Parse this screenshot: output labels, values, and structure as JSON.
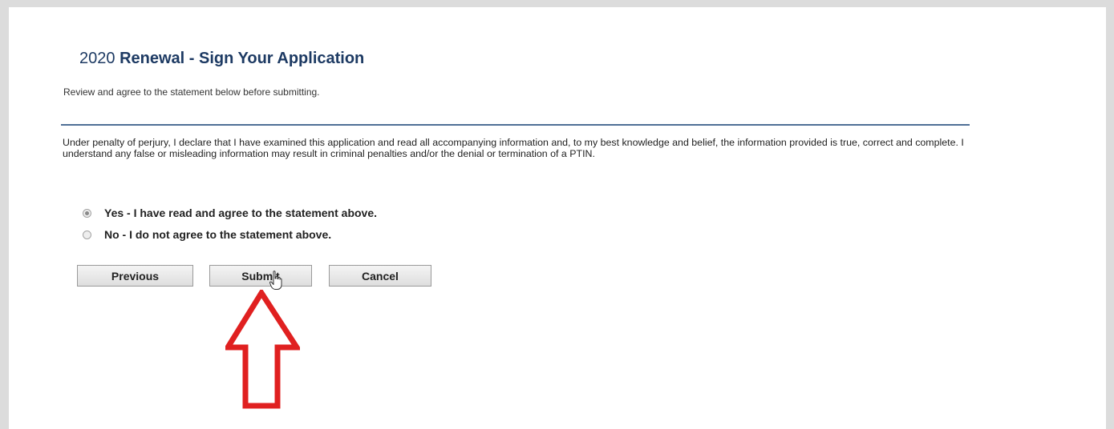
{
  "page": {
    "title_year": "2020",
    "title_main": "Renewal - Sign Your Application",
    "instruction": "Review and agree to the statement below before submitting.",
    "statement": "Under penalty of perjury, I declare that I have examined this application and read all accompanying information and, to my best knowledge and belief, the information provided is true, correct and complete. I understand any false or misleading information may result in criminal penalties and/or the denial or termination of a PTIN."
  },
  "radio_options": [
    {
      "label": "Yes - I have read and agree to the statement above.",
      "checked": true
    },
    {
      "label": "No - I do not agree to the statement above.",
      "checked": false
    }
  ],
  "buttons": {
    "previous": "Previous",
    "submit": "Submit",
    "cancel": "Cancel"
  },
  "colors": {
    "title": "#1d3a63",
    "divider": "#4f6f96",
    "annotation_arrow": "#e02020",
    "frame": "#dcdcdc"
  },
  "icons": {
    "cursor": "pointer-hand-icon",
    "annotation": "red-arrow-up-icon"
  }
}
